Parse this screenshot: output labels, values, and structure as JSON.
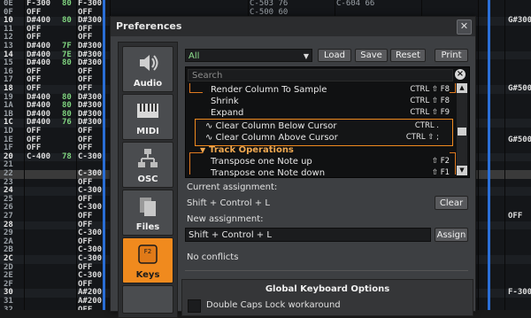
{
  "pattern": {
    "rows": [
      {
        "n": "0E",
        "c1": "F-300",
        "v1": "80",
        "c2": "F-300",
        "v2": "80",
        "c3": "C-503 76",
        "c4": "C-604 66",
        "c5": ""
      },
      {
        "n": "0F",
        "c1": "OFF",
        "v1": "",
        "c2": "OFF",
        "v2": "",
        "c3": "C-500 60",
        "c4": "",
        "c5": ""
      },
      {
        "n": "10",
        "c1": "D#400",
        "v1": "80",
        "c2": "D#300",
        "v2": "",
        "c3": "",
        "c4": "",
        "c5": "G#300"
      },
      {
        "n": "11",
        "c1": "OFF",
        "v1": "",
        "c2": "OFF",
        "v2": "",
        "c3": "",
        "c4": "",
        "c5": ""
      },
      {
        "n": "12",
        "c1": "OFF",
        "v1": "",
        "c2": "OFF",
        "v2": "",
        "c3": "",
        "c4": "",
        "c5": ""
      },
      {
        "n": "13",
        "c1": "D#400",
        "v1": "7F",
        "c2": "D#300",
        "v2": "",
        "c3": "",
        "c4": "",
        "c5": ""
      },
      {
        "n": "14",
        "c1": "D#400",
        "v1": "7E",
        "c2": "D#300",
        "v2": "",
        "c3": "",
        "c4": "",
        "c5": ""
      },
      {
        "n": "15",
        "c1": "D#400",
        "v1": "80",
        "c2": "D#300",
        "v2": "",
        "c3": "",
        "c4": "",
        "c5": ""
      },
      {
        "n": "16",
        "c1": "OFF",
        "v1": "",
        "c2": "OFF",
        "v2": "",
        "c3": "",
        "c4": "",
        "c5": ""
      },
      {
        "n": "17",
        "c1": "OFF",
        "v1": "",
        "c2": "OFF",
        "v2": "",
        "c3": "",
        "c4": "",
        "c5": ""
      },
      {
        "n": "18",
        "c1": "OFF",
        "v1": "",
        "c2": "OFF",
        "v2": "",
        "c3": "",
        "c4": "",
        "c5": "G#500"
      },
      {
        "n": "19",
        "c1": "D#400",
        "v1": "80",
        "c2": "D#300",
        "v2": "",
        "c3": "",
        "c4": "",
        "c5": ""
      },
      {
        "n": "1A",
        "c1": "D#400",
        "v1": "80",
        "c2": "D#300",
        "v2": "",
        "c3": "",
        "c4": "",
        "c5": ""
      },
      {
        "n": "1B",
        "c1": "D#400",
        "v1": "80",
        "c2": "D#300",
        "v2": "",
        "c3": "",
        "c4": "",
        "c5": ""
      },
      {
        "n": "1C",
        "c1": "D#400",
        "v1": "76",
        "c2": "D#300",
        "v2": "",
        "c3": "",
        "c4": "",
        "c5": ""
      },
      {
        "n": "1D",
        "c1": "OFF",
        "v1": "",
        "c2": "OFF",
        "v2": "",
        "c3": "",
        "c4": "",
        "c5": ""
      },
      {
        "n": "1E",
        "c1": "OFF",
        "v1": "",
        "c2": "OFF",
        "v2": "",
        "c3": "",
        "c4": "",
        "c5": "G#500"
      },
      {
        "n": "1F",
        "c1": "OFF",
        "v1": "",
        "c2": "OFF",
        "v2": "",
        "c3": "",
        "c4": "",
        "c5": ""
      },
      {
        "n": "20",
        "c1": "C-400",
        "v1": "78",
        "c2": "C-300",
        "v2": "",
        "c3": "",
        "c4": "",
        "c5": ""
      },
      {
        "n": "21",
        "c1": "",
        "v1": "",
        "c2": "",
        "v2": "",
        "c3": "",
        "c4": "",
        "c5": ""
      },
      {
        "n": "22",
        "c1": "",
        "v1": "",
        "c2": "C-300",
        "v2": "",
        "c3": "",
        "c4": "",
        "c5": ""
      },
      {
        "n": "23",
        "c1": "",
        "v1": "",
        "c2": "OFF",
        "v2": "",
        "c3": "",
        "c4": "",
        "c5": ""
      },
      {
        "n": "24",
        "c1": "",
        "v1": "",
        "c2": "C-300",
        "v2": "",
        "c3": "",
        "c4": "",
        "c5": ""
      },
      {
        "n": "25",
        "c1": "",
        "v1": "",
        "c2": "OFF",
        "v2": "",
        "c3": "",
        "c4": "",
        "c5": ""
      },
      {
        "n": "26",
        "c1": "",
        "v1": "",
        "c2": "C-300",
        "v2": "",
        "c3": "",
        "c4": "",
        "c5": ""
      },
      {
        "n": "27",
        "c1": "",
        "v1": "",
        "c2": "OFF",
        "v2": "",
        "c3": "",
        "c4": "",
        "c5": "OFF"
      },
      {
        "n": "28",
        "c1": "",
        "v1": "",
        "c2": "OFF",
        "v2": "",
        "c3": "",
        "c4": "",
        "c5": ""
      },
      {
        "n": "29",
        "c1": "",
        "v1": "",
        "c2": "C-300",
        "v2": "",
        "c3": "",
        "c4": "",
        "c5": ""
      },
      {
        "n": "2A",
        "c1": "",
        "v1": "",
        "c2": "OFF",
        "v2": "",
        "c3": "",
        "c4": "",
        "c5": ""
      },
      {
        "n": "2B",
        "c1": "",
        "v1": "",
        "c2": "C-300",
        "v2": "",
        "c3": "",
        "c4": "",
        "c5": ""
      },
      {
        "n": "2C",
        "c1": "",
        "v1": "",
        "c2": "C-300",
        "v2": "",
        "c3": "",
        "c4": "",
        "c5": ""
      },
      {
        "n": "2D",
        "c1": "",
        "v1": "",
        "c2": "OFF",
        "v2": "",
        "c3": "",
        "c4": "",
        "c5": ""
      },
      {
        "n": "2E",
        "c1": "",
        "v1": "",
        "c2": "C-300",
        "v2": "",
        "c3": "",
        "c4": "",
        "c5": ""
      },
      {
        "n": "2F",
        "c1": "",
        "v1": "",
        "c2": "OFF",
        "v2": "",
        "c3": "",
        "c4": "",
        "c5": ""
      },
      {
        "n": "30",
        "c1": "",
        "v1": "",
        "c2": "A#200",
        "v2": "",
        "c3": "",
        "c4": "",
        "c5": "F-300"
      },
      {
        "n": "31",
        "c1": "",
        "v1": "",
        "c2": "A#200",
        "v2": "",
        "c3": "",
        "c4": "",
        "c5": ""
      },
      {
        "n": "32",
        "c1": "",
        "v1": "",
        "c2": "OFF",
        "v2": "",
        "c3": "",
        "c4": "",
        "c5": ""
      }
    ]
  },
  "dialog": {
    "title": "Preferences",
    "close_glyph": "✕",
    "sidebar": [
      {
        "id": "audio",
        "label": "Audio"
      },
      {
        "id": "midi",
        "label": "MIDI"
      },
      {
        "id": "osc",
        "label": "OSC"
      },
      {
        "id": "files",
        "label": "Files"
      },
      {
        "id": "keys",
        "label": "Keys",
        "icon_text": "F2"
      }
    ],
    "filter": {
      "value": "All"
    },
    "toolbar": {
      "load": "Load",
      "save": "Save",
      "reset": "Reset",
      "print": "Print"
    },
    "search": {
      "placeholder": "Search"
    },
    "list": [
      {
        "label": "Render Column To Sample",
        "shortcut": "CTRL ⇧ F8",
        "type": "item"
      },
      {
        "label": "Shrink",
        "shortcut": "CTRL ⇧ F8",
        "type": "item"
      },
      {
        "label": "Expand",
        "shortcut": "CTRL ⇧ F9",
        "type": "item"
      },
      {
        "label": "∿ Clear Column Below Cursor",
        "shortcut": "CTRL .",
        "type": "item"
      },
      {
        "label": "∿ Clear Column Above Cursor",
        "shortcut": "CTRL ⇧ ;",
        "type": "item"
      },
      {
        "label": "Track Operations",
        "shortcut": "",
        "type": "group"
      },
      {
        "label": "Transpose one Note up",
        "shortcut": "⇧ F2",
        "type": "item"
      },
      {
        "label": "Transpose one Note down",
        "shortcut": "⇧ F1",
        "type": "item"
      }
    ],
    "current_assignment": {
      "label": "Current assignment:",
      "value": "Shift + Control + L",
      "clear": "Clear"
    },
    "new_assignment": {
      "label": "New assignment:",
      "value": "Shift + Control + L",
      "assign": "Assign"
    },
    "conflicts": "No conflicts",
    "global": {
      "heading": "Global Keyboard Options",
      "option": "Double Caps Lock workaround"
    }
  },
  "colors": {
    "accent": "#f08a1e",
    "volume": "#7fd37f",
    "group": "#f0a850"
  }
}
